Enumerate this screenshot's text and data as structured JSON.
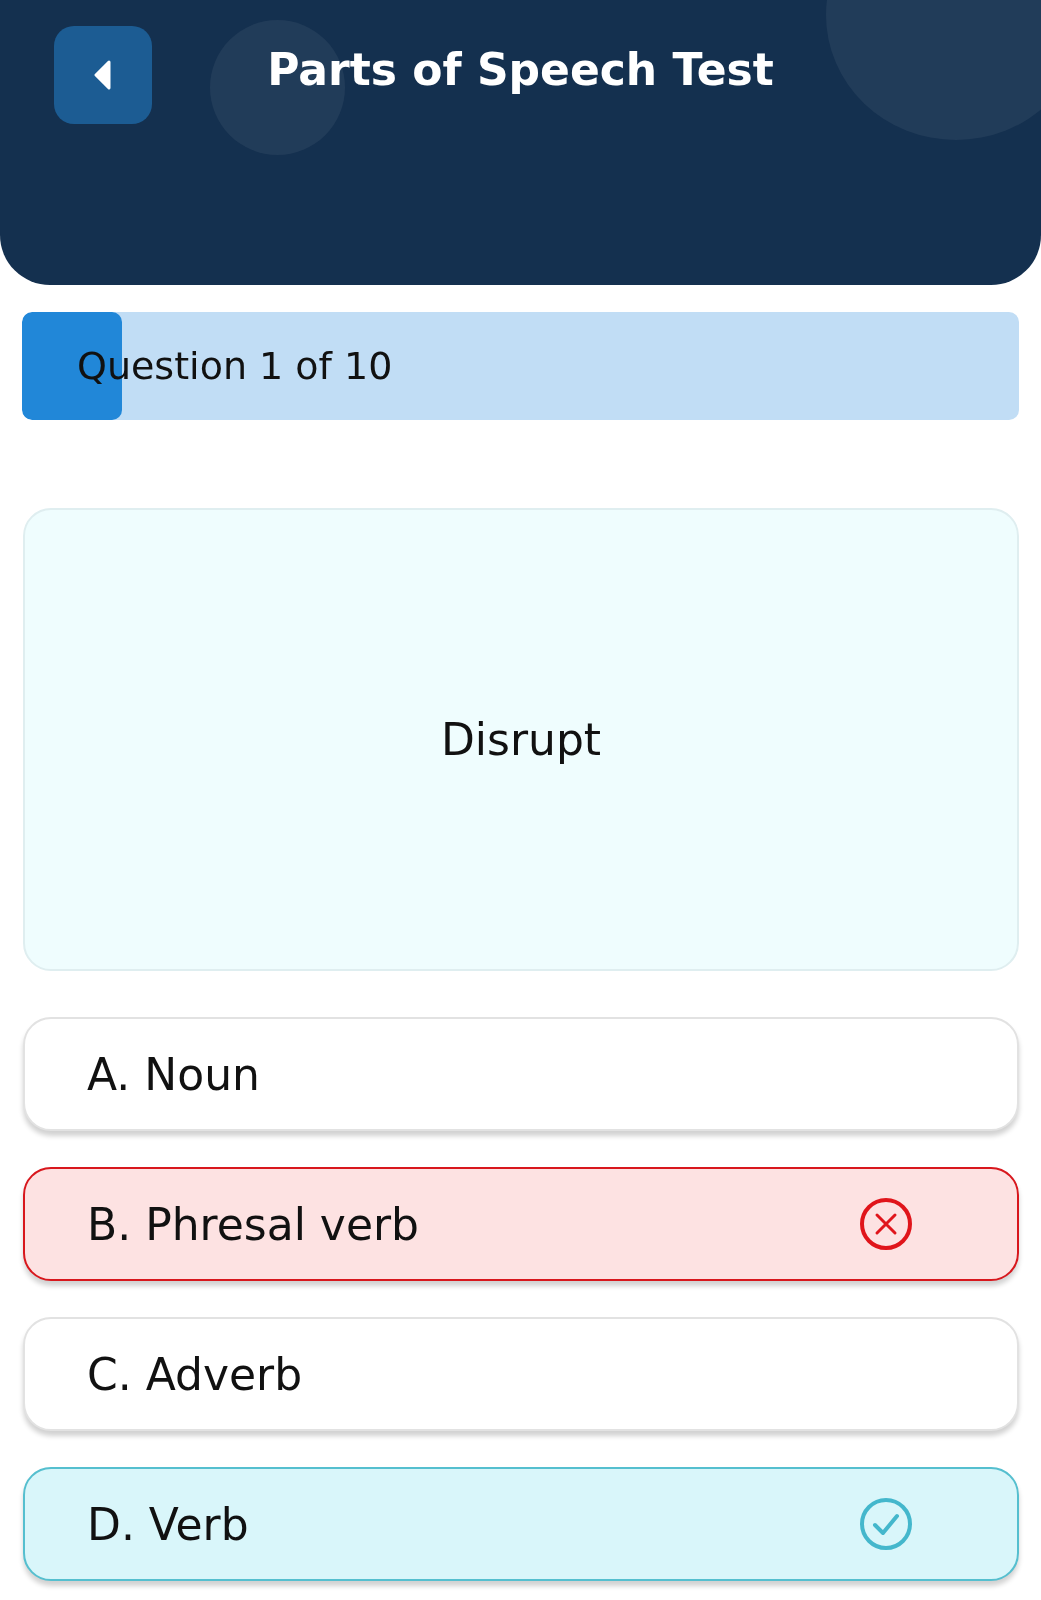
{
  "header": {
    "title": "Parts of Speech Test"
  },
  "progress": {
    "label": "Question 1 of 10",
    "level": 0.1
  },
  "question": {
    "word": "Disrupt"
  },
  "options": [
    {
      "label": "A. Noun",
      "kind": "plain"
    },
    {
      "label": "B. Phresal verb",
      "kind": "wrong"
    },
    {
      "label": "C. Adverb",
      "kind": "plain"
    },
    {
      "label": "D. Verb",
      "kind": "correct"
    }
  ]
}
